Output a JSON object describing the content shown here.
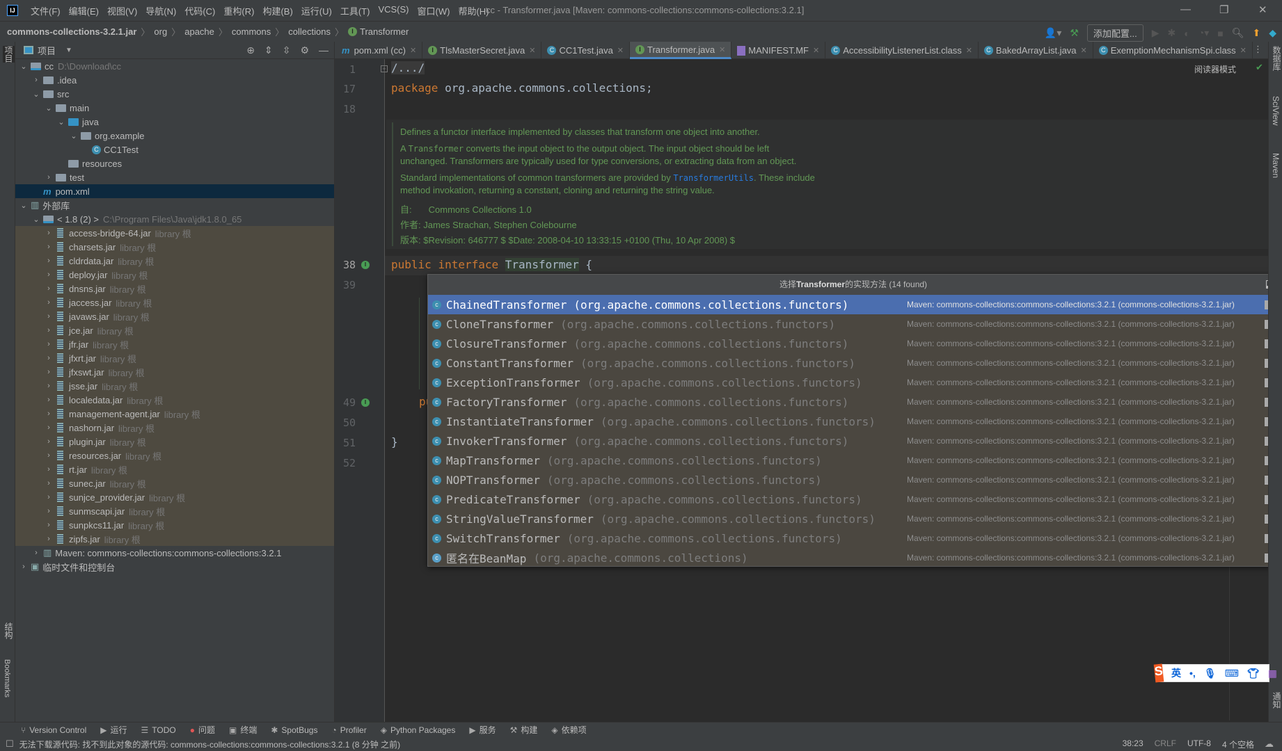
{
  "app": {
    "logo": "IJ",
    "title": "cc - Transformer.java [Maven: commons-collections:commons-collections:3.2.1]"
  },
  "menu": [
    "文件(F)",
    "编辑(E)",
    "视图(V)",
    "导航(N)",
    "代码(C)",
    "重构(R)",
    "构建(B)",
    "运行(U)",
    "工具(T)",
    "VCS(S)",
    "窗口(W)",
    "帮助(H)"
  ],
  "breadcrumb": [
    "commons-collections-3.2.1.jar",
    "org",
    "apache",
    "commons",
    "collections",
    "Transformer"
  ],
  "toolbar": {
    "add_config": "添加配置..."
  },
  "left_strip": {
    "project": "项目",
    "structure": "结构",
    "bookmarks": "Bookmarks"
  },
  "right_strip": {
    "database": "数据库",
    "sciview": "SciView",
    "maven": "Maven",
    "notifications": "通知"
  },
  "sidebar": {
    "title": "项目",
    "tree": [
      {
        "level": 0,
        "arrow": "down",
        "icon": "module",
        "label": "cc",
        "hint": "D:\\Download\\cc"
      },
      {
        "level": 1,
        "arrow": "right",
        "icon": "folder",
        "label": ".idea"
      },
      {
        "level": 1,
        "arrow": "down",
        "icon": "folder",
        "label": "src"
      },
      {
        "level": 2,
        "arrow": "down",
        "icon": "folder",
        "label": "main"
      },
      {
        "level": 3,
        "arrow": "down",
        "icon": "folder-blue",
        "label": "java"
      },
      {
        "level": 4,
        "arrow": "down",
        "icon": "package",
        "label": "org.example"
      },
      {
        "level": 5,
        "arrow": "",
        "icon": "class",
        "label": "CC1Test"
      },
      {
        "level": 3,
        "arrow": "",
        "icon": "folder",
        "label": "resources"
      },
      {
        "level": 2,
        "arrow": "right",
        "icon": "folder",
        "label": "test"
      },
      {
        "level": 1,
        "arrow": "",
        "icon": "maven",
        "label": "pom.xml",
        "selected": true
      },
      {
        "level": 0,
        "arrow": "down",
        "icon": "libraries",
        "label": "外部库"
      },
      {
        "level": 1,
        "arrow": "down",
        "icon": "jdk",
        "label": "< 1.8 (2) >",
        "hint": "C:\\Program Files\\Java\\jdk1.8.0_65"
      }
    ],
    "jars": [
      "access-bridge-64.jar",
      "charsets.jar",
      "cldrdata.jar",
      "deploy.jar",
      "dnsns.jar",
      "jaccess.jar",
      "javaws.jar",
      "jce.jar",
      "jfr.jar",
      "jfxrt.jar",
      "jfxswt.jar",
      "jsse.jar",
      "localedata.jar",
      "management-agent.jar",
      "nashorn.jar",
      "plugin.jar",
      "resources.jar",
      "rt.jar",
      "sunec.jar",
      "sunjce_provider.jar",
      "sunmscapi.jar",
      "sunpkcs11.jar",
      "zipfs.jar"
    ],
    "jar_hint": "library 根",
    "tail": [
      {
        "level": 1,
        "arrow": "right",
        "icon": "libraries",
        "label": "Maven: commons-collections:commons-collections:3.2.1"
      },
      {
        "level": 0,
        "arrow": "right",
        "icon": "scratch",
        "label": "临时文件和控制台"
      }
    ]
  },
  "tabs": [
    {
      "label": "pom.xml (cc)",
      "icon": "maven"
    },
    {
      "label": "TlsMasterSecret.java",
      "icon": "interface"
    },
    {
      "label": "CC1Test.java",
      "icon": "class"
    },
    {
      "label": "Transformer.java",
      "icon": "interface",
      "active": true
    },
    {
      "label": "MANIFEST.MF",
      "icon": "manifest"
    },
    {
      "label": "AccessibilityListenerList.class",
      "icon": "class"
    },
    {
      "label": "BakedArrayList.java",
      "icon": "class"
    },
    {
      "label": "ExemptionMechanismSpi.class",
      "icon": "class"
    }
  ],
  "editor": {
    "reader_mode": "阅读器模式",
    "line_numbers": {
      "l1": "1",
      "l17": "17",
      "l18": "18",
      "l38": "38",
      "l39": "39",
      "l49": "49",
      "l50": "50",
      "l51": "51",
      "l52": "52"
    },
    "folded": "/.../",
    "package_kw": "package",
    "package_name": " org.apache.commons.collections;",
    "decl_kw1": "public",
    "decl_kw2": "interface",
    "decl_name": "Transformer",
    "decl_brace": " {",
    "line49": "pu",
    "line51": "}",
    "doc": {
      "p1": "Defines a functor interface implemented by classes that transform one object into another.",
      "p2a": "A ",
      "p2code": "Transformer",
      "p2b": " converts the input object to the output object. The input object should be left",
      "p2c": "unchanged. Transformers are typically used for type conversions, or extracting data from an object.",
      "p3a": "Standard implementations of common transformers are provided by ",
      "p3link": "TransformerUtils",
      "p3b": ". These include",
      "p3c": "method invokation, returning a constant, cloning and returning the string value.",
      "since_label": "自:",
      "since": "Commons Collections 1.0",
      "author_label": "作者:",
      "author": "James Strachan, Stephen Colebourne",
      "version_label": "版本:",
      "version": "$Revision: 646777 $ $Date: 2008-04-10 13:33:15 +0100 (Thu, 10 Apr 2008) $"
    }
  },
  "popup": {
    "title_pre": "选择",
    "title_bold": "Transformer",
    "title_post": "的实现方法 (14 found)",
    "location": "Maven: commons-collections:commons-collections:3.2.1 (commons-collections-3.2.1.jar)",
    "items": [
      {
        "name": "ChainedTransformer",
        "pkg": "(org.apache.commons.collections.functors)"
      },
      {
        "name": "CloneTransformer",
        "pkg": "(org.apache.commons.collections.functors)"
      },
      {
        "name": "ClosureTransformer",
        "pkg": "(org.apache.commons.collections.functors)"
      },
      {
        "name": "ConstantTransformer",
        "pkg": "(org.apache.commons.collections.functors)"
      },
      {
        "name": "ExceptionTransformer",
        "pkg": "(org.apache.commons.collections.functors)"
      },
      {
        "name": "FactoryTransformer",
        "pkg": "(org.apache.commons.collections.functors)"
      },
      {
        "name": "InstantiateTransformer",
        "pkg": "(org.apache.commons.collections.functors)"
      },
      {
        "name": "InvokerTransformer",
        "pkg": "(org.apache.commons.collections.functors)"
      },
      {
        "name": "MapTransformer",
        "pkg": "(org.apache.commons.collections.functors)"
      },
      {
        "name": "NOPTransformer",
        "pkg": "(org.apache.commons.collections.functors)"
      },
      {
        "name": "PredicateTransformer",
        "pkg": "(org.apache.commons.collections.functors)"
      },
      {
        "name": "StringValueTransformer",
        "pkg": "(org.apache.commons.collections.functors)"
      },
      {
        "name": "SwitchTransformer",
        "pkg": "(org.apache.commons.collections.functors)"
      },
      {
        "name": "匿名在BeanMap",
        "pkg": "(org.apache.commons.collections)"
      }
    ]
  },
  "bottom_tools": [
    "Version Control",
    "运行",
    "TODO",
    "问题",
    "终端",
    "SpotBugs",
    "Profiler",
    "Python Packages",
    "服务",
    "构建",
    "依赖项"
  ],
  "status": {
    "message": "无法下载源代码: 找不到此对象的源代码: commons-collections:commons-collections:3.2.1 (8 分钟 之前)",
    "position": "38:23",
    "line_sep": "CRLF",
    "encoding": "UTF-8",
    "indent": "4 个空格"
  },
  "ime": {
    "lang": "英",
    "punct": "•,"
  },
  "colors": {
    "accent": "#4b6eaf",
    "keyword": "#cc7832",
    "doc": "#629755",
    "library_bg": "#4e4a40"
  }
}
